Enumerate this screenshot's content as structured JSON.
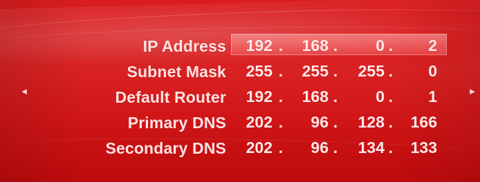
{
  "navigation": {
    "left_arrow": "◂",
    "right_arrow": "▸"
  },
  "network_settings": [
    {
      "label": "IP Address",
      "octets": [
        "192",
        "168",
        "0",
        "2"
      ],
      "separators": [
        ".",
        ".",
        "."
      ]
    },
    {
      "label": "Subnet Mask",
      "octets": [
        "255",
        "255",
        "255",
        "0"
      ],
      "separators": [
        ".",
        ".",
        "."
      ]
    },
    {
      "label": "Default Router",
      "octets": [
        "192",
        "168",
        "0",
        "1"
      ],
      "separators": [
        ".",
        ".",
        "."
      ]
    },
    {
      "label": "Primary DNS",
      "octets": [
        "202",
        "96",
        "128",
        "166"
      ],
      "separators": [
        ".",
        ".",
        "."
      ]
    },
    {
      "label": "Secondary DNS",
      "octets": [
        "202",
        "96",
        "134",
        "133"
      ],
      "separators": [
        ".",
        ".",
        "."
      ]
    }
  ],
  "theme": {
    "background": "#d81214",
    "text": "#ffe3e3",
    "selection": "#ff9a9a"
  }
}
